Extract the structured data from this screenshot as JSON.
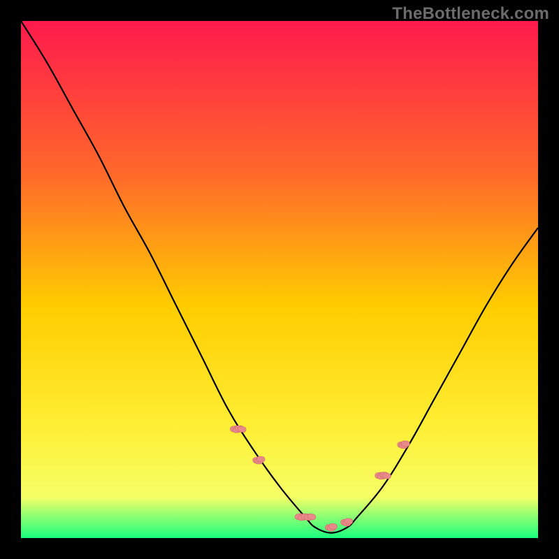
{
  "watermark": "TheBottleneck.com",
  "colors": {
    "gradient_top": "#ff1a4d",
    "gradient_mid1": "#ff6a2a",
    "gradient_mid2": "#ffcc00",
    "gradient_mid3": "#ffee33",
    "gradient_bottom_y": "#f6ff66",
    "gradient_bottom_g": "#1aff80",
    "curve": "#000000",
    "dot_fill": "#e88a8a",
    "dot_stroke": "#d06868",
    "frame_bg": "#000000"
  },
  "chart_data": {
    "type": "line",
    "title": "",
    "xlabel": "",
    "ylabel": "",
    "xlim": [
      0,
      100
    ],
    "ylim": [
      0,
      100
    ],
    "series": [
      {
        "name": "curve",
        "x": [
          0,
          5,
          10,
          15,
          20,
          25,
          30,
          35,
          40,
          45,
          50,
          55,
          57,
          60,
          63,
          65,
          70,
          75,
          80,
          85,
          90,
          95,
          100
        ],
        "y": [
          100,
          92,
          83,
          74,
          64,
          55,
          45,
          35,
          25,
          17,
          10,
          4,
          2,
          1,
          2,
          4,
          10,
          18,
          27,
          36,
          45,
          53,
          60
        ]
      }
    ],
    "annotations": {
      "dot_clusters": [
        {
          "cx": 42,
          "cy": 21,
          "n": 4,
          "spread": 4
        },
        {
          "cx": 46,
          "cy": 15,
          "n": 3,
          "spread": 3
        },
        {
          "cx": 55,
          "cy": 4,
          "n": 5,
          "spread": 5
        },
        {
          "cx": 60,
          "cy": 2,
          "n": 3,
          "spread": 3
        },
        {
          "cx": 63,
          "cy": 3,
          "n": 3,
          "spread": 3
        },
        {
          "cx": 70,
          "cy": 12,
          "n": 4,
          "spread": 4
        },
        {
          "cx": 74,
          "cy": 18,
          "n": 3,
          "spread": 3
        }
      ]
    }
  }
}
